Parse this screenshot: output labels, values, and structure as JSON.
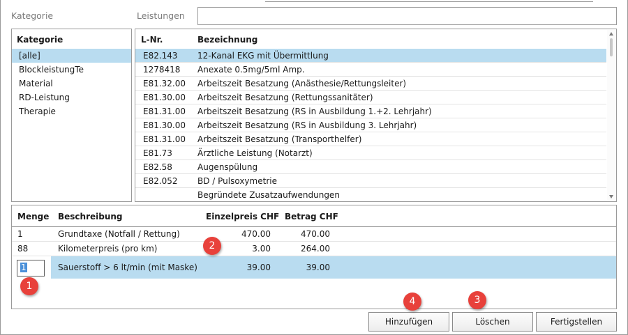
{
  "top": {
    "kategorie_label": "Kategorie",
    "leistungen_label": "Leistungen",
    "search_value": ""
  },
  "categories": {
    "header": "Kategorie",
    "items": [
      "[alle]",
      "BlockleistungTe",
      "Material",
      "RD-Leistung",
      "Therapie"
    ],
    "selected_index": 0
  },
  "services": {
    "headers": {
      "nr": "L-Nr.",
      "desc": "Bezeichnung"
    },
    "rows": [
      {
        "nr": "E82.143",
        "desc": "12-Kanal EKG mit Übermittlung"
      },
      {
        "nr": "1278418",
        "desc": "Anexate 0.5mg/5ml Amp."
      },
      {
        "nr": "E81.32.00",
        "desc": "Arbeitszeit Besatzung (Anästhesie/Rettungsleiter)"
      },
      {
        "nr": "E81.30.00",
        "desc": "Arbeitszeit Besatzung (Rettungssanitäter)"
      },
      {
        "nr": "E81.31.00",
        "desc": "Arbeitszeit Besatzung (RS in Ausbildung 1.+2. Lehrjahr)"
      },
      {
        "nr": "E81.30.00",
        "desc": "Arbeitszeit Besatzung (RS in Ausbildung 3. Lehrjahr)"
      },
      {
        "nr": "E81.31.00",
        "desc": "Arbeitszeit Besatzung (Transporthelfer)"
      },
      {
        "nr": "E81.73",
        "desc": "Ärztliche Leistung (Notarzt)"
      },
      {
        "nr": "E82.58",
        "desc": "Augenspülung"
      },
      {
        "nr": "E82.052",
        "desc": "BD / Pulsoxymetrie"
      },
      {
        "nr": "",
        "desc": "Begründete Zusatzaufwendungen"
      }
    ],
    "selected_index": 0
  },
  "positions": {
    "headers": {
      "qty": "Menge",
      "desc": "Beschreibung",
      "unit": "Einzelpreis CHF",
      "total": "Betrag CHF"
    },
    "rows": [
      {
        "qty": "1",
        "desc": "Grundtaxe (Notfall / Rettung)",
        "unit": "470.00",
        "total": "470.00"
      },
      {
        "qty": "88",
        "desc": "Kilometerpreis (pro km)",
        "unit": "3.00",
        "total": "264.00"
      },
      {
        "qty": "1",
        "desc": "Sauerstoff > 6 lt/min (mit Maske)",
        "unit": "39.00",
        "total": "39.00"
      }
    ],
    "selected_index": 2
  },
  "buttons": {
    "add": "Hinzufügen",
    "delete": "Löschen",
    "finish": "Fertigstellen"
  },
  "badges": [
    "1",
    "2",
    "3",
    "4"
  ],
  "colors": {
    "selection": "#b9dcf0",
    "badge": "#e8413b"
  }
}
